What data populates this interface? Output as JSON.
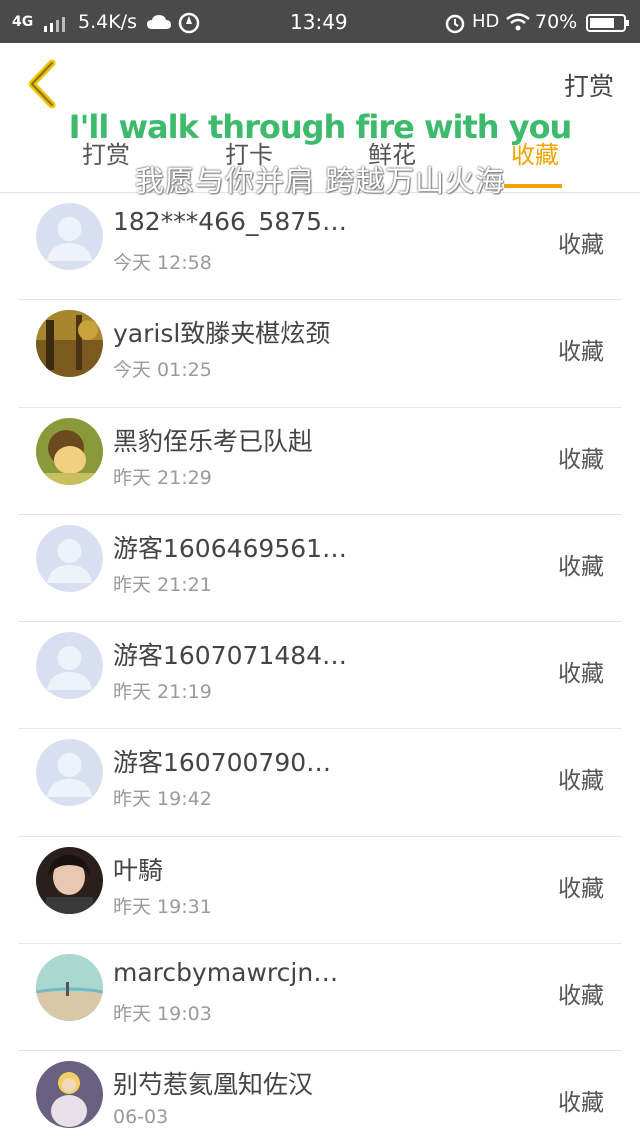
{
  "status_bar": {
    "network": "4G",
    "speed": "5.4K/s",
    "time": "13:49",
    "hd": "HD",
    "battery": "70%"
  },
  "header": {
    "action_label": "打赏"
  },
  "tabs": [
    {
      "label": "打赏"
    },
    {
      "label": "打卡"
    },
    {
      "label": "鲜花"
    },
    {
      "label": "收藏",
      "active": true
    }
  ],
  "overlay": {
    "en": "I'll walk through fire with you",
    "zh": "我愿与你并肩 跨越万山火海"
  },
  "colors": {
    "accent": "#f0a500",
    "overlay_green": "#3dba6c"
  },
  "list": [
    {
      "name": "182***466_5875…",
      "time": "今天 12:58",
      "action": "收藏",
      "avatar": "default-avatar"
    },
    {
      "name": "yarisl致滕夹椹炫颈",
      "time": "今天 01:25",
      "action": "收藏",
      "avatar": "photo-avatar"
    },
    {
      "name": "黑豹侄乐考已队赳",
      "time": "昨天 21:29",
      "action": "收藏",
      "avatar": "photo-avatar"
    },
    {
      "name": "游客1606469561…",
      "time": "昨天 21:21",
      "action": "收藏",
      "avatar": "default-avatar"
    },
    {
      "name": "游客1607071484…",
      "time": "昨天 21:19",
      "action": "收藏",
      "avatar": "default-avatar"
    },
    {
      "name": "游客160700790…",
      "time": "昨天 19:42",
      "action": "收藏",
      "avatar": "default-avatar"
    },
    {
      "name": "叶騎",
      "time": "昨天 19:31",
      "action": "收藏",
      "avatar": "photo-avatar"
    },
    {
      "name": "marcbymawrcjn…",
      "time": "昨天 19:03",
      "action": "收藏",
      "avatar": "photo-avatar"
    },
    {
      "name": "别芍惹氦凰知佐汉",
      "time": "06-03",
      "action": "收藏",
      "avatar": "photo-avatar"
    }
  ]
}
